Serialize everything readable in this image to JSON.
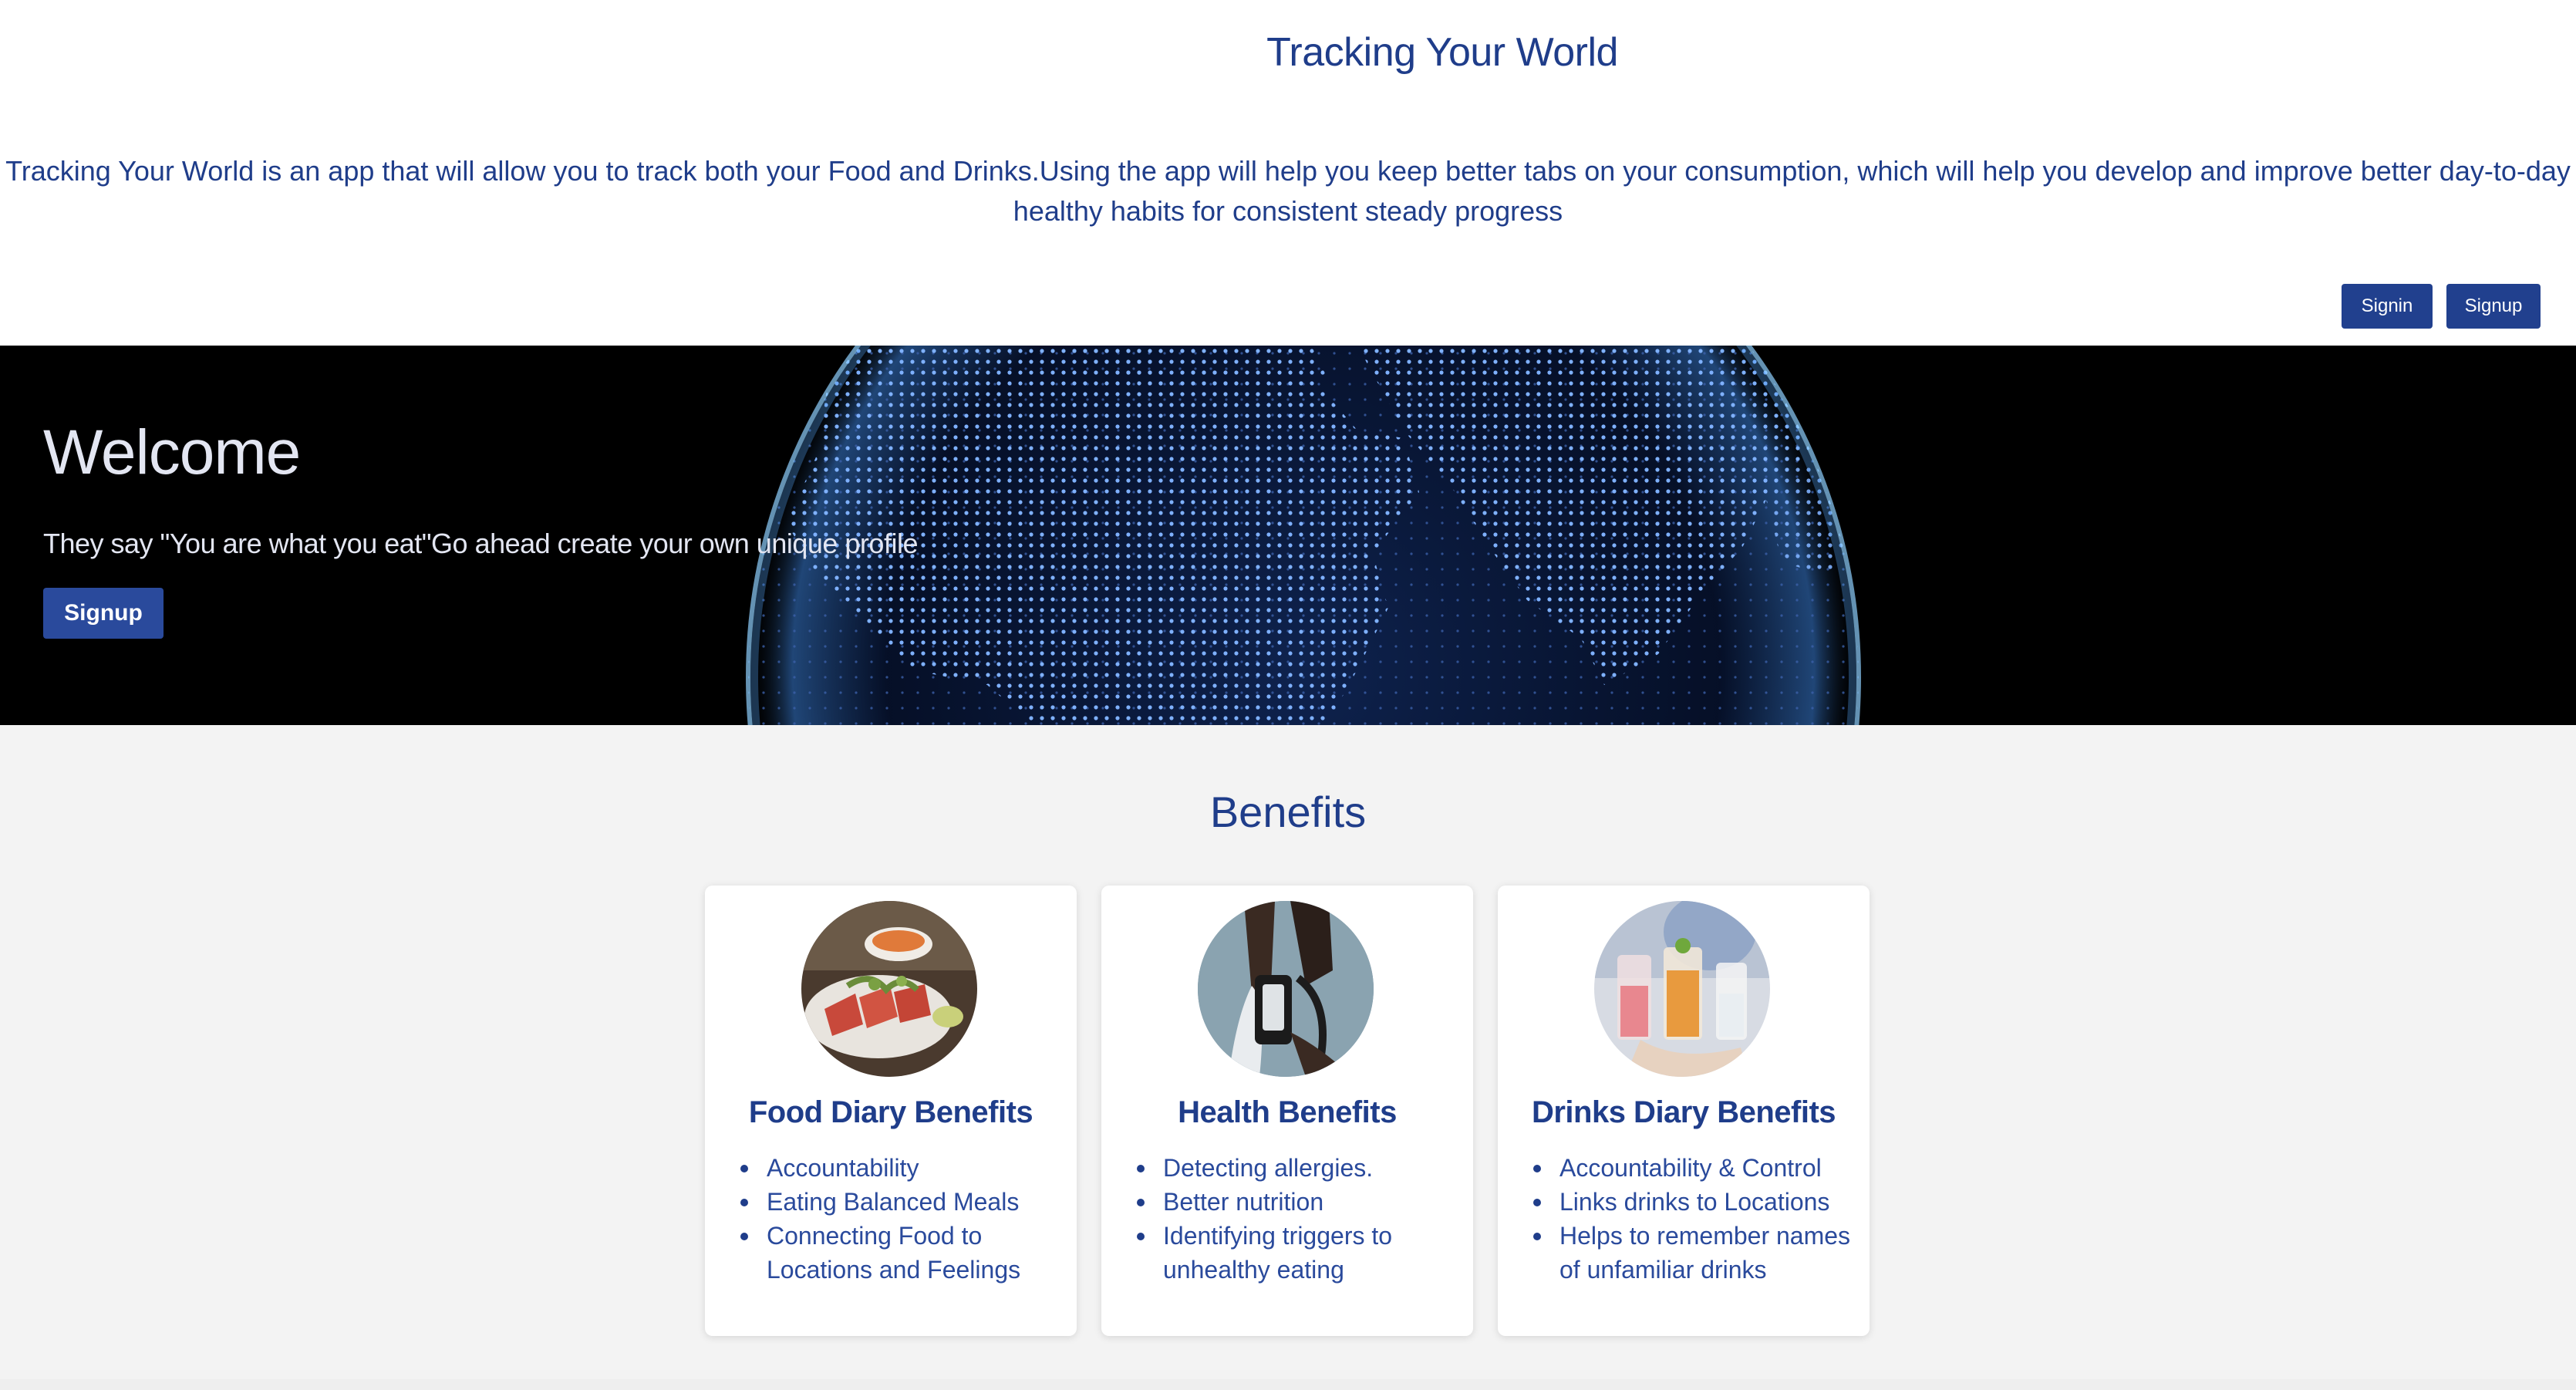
{
  "header": {
    "title": "Tracking Your World",
    "description": "Tracking Your World is an app that will allow you to track both your Food and Drinks.Using the app will help you keep better tabs on your consumption, which will help you develop and improve better day-to-day healthy habits for consistent steady progress",
    "signin_label": "Signin",
    "signup_label": "Signup"
  },
  "hero": {
    "title": "Welcome",
    "subtitle": "They say \"You are what you eat\"Go ahead create your own unique profile",
    "button_label": "Signup"
  },
  "benefits": {
    "title": "Benefits",
    "cards": [
      {
        "title": "Food Diary Benefits",
        "image": "food-plate-photo",
        "items": [
          "Accountability",
          "Eating Balanced Meals",
          "Connecting Food to Locations and Feelings"
        ]
      },
      {
        "title": "Health Benefits",
        "image": "blood-pressure-photo",
        "items": [
          "Detecting allergies.",
          "Better nutrition",
          "Identifying triggers to unhealthy eating"
        ]
      },
      {
        "title": "Drinks Diary Benefits",
        "image": "cocktail-drinks-photo",
        "items": [
          "Accountability & Control",
          "Links drinks to Locations",
          "Helps to remember names of unfamiliar drinks"
        ]
      }
    ]
  },
  "colors": {
    "brand": "#1f3d8a",
    "button": "#21408e",
    "hero_bg": "#000000",
    "section_bg": "#f3f3f3"
  }
}
